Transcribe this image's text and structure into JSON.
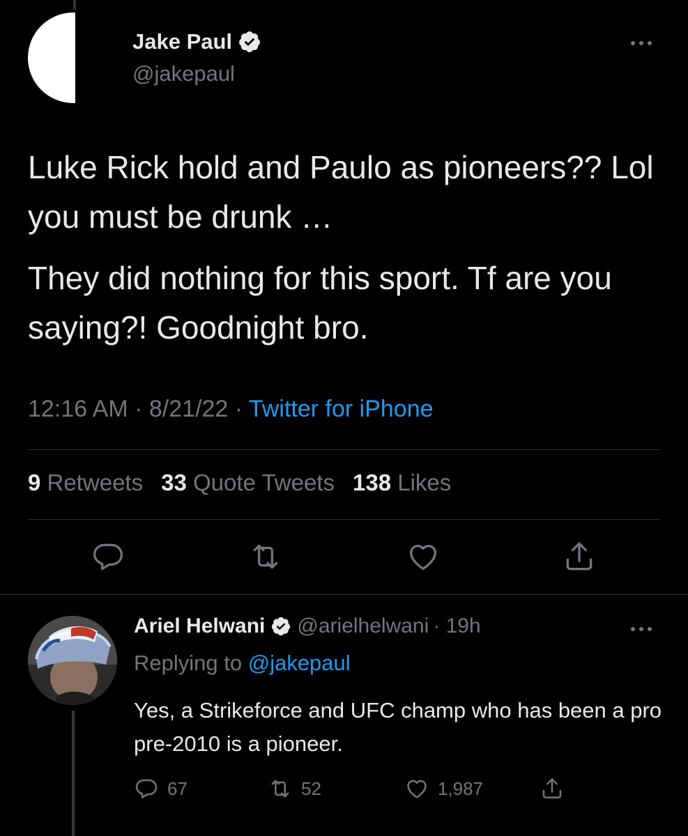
{
  "main_tweet": {
    "author_name": "Jake Paul",
    "author_handle": "@jakepaul",
    "paragraphs": [
      "Luke Rick hold and Paulo as pioneers?? Lol you must be drunk …",
      "They did nothing for this sport. Tf are you saying?! Goodnight bro."
    ],
    "time": "12:16 AM",
    "separator": "·",
    "date": "8/21/22",
    "source": "Twitter for iPhone",
    "stats": {
      "retweets_count": "9",
      "retweets_label": "Retweets",
      "quotes_count": "33",
      "quotes_label": "Quote Tweets",
      "likes_count": "138",
      "likes_label": "Likes"
    },
    "actions": [
      "reply-icon",
      "retweet-icon",
      "like-icon",
      "share-icon"
    ]
  },
  "reply_tweet": {
    "author_name": "Ariel Helwani",
    "author_handle": "@arielhelwani",
    "time_ago": "· 19h",
    "replying_prefix": "Replying to",
    "replying_to": "@jakepaul",
    "text": "Yes, a Strikeforce and UFC champ who has been a pro pre-2010 is a pioneer.",
    "reply_count": "67",
    "retweet_count": "52",
    "like_count": "1,987"
  },
  "colors": {
    "background": "#000000",
    "text": "#e7e9ea",
    "muted": "#71767b",
    "accent": "#1d9bf0",
    "divider": "#2f3336"
  }
}
